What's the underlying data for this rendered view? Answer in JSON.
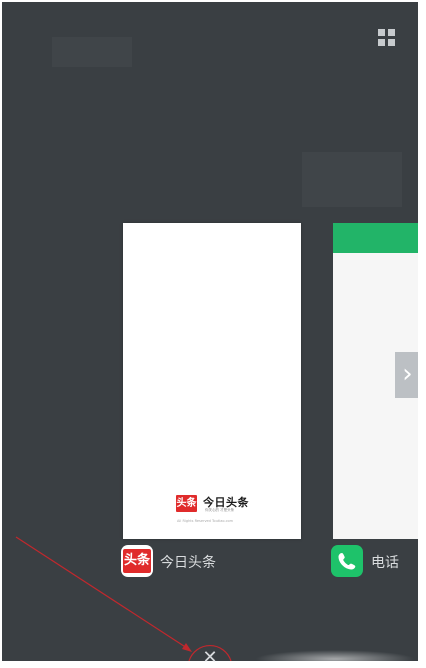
{
  "toolbar": {
    "layout_icon": "grid-view-icon"
  },
  "cards": [
    {
      "app_name": "今日头条",
      "icon_text": "头条",
      "splash": {
        "logo_text": "头条",
        "title": "今日头条",
        "slogan": "你关心的 才是头条",
        "copyright": "All Rights Reserved Toutiao.com"
      }
    },
    {
      "app_name": "电话",
      "icon": "phone-icon"
    }
  ],
  "navigation": {
    "next_icon": "chevron-right-icon"
  },
  "bottom": {
    "close_icon": "close-icon"
  },
  "colors": {
    "background": "#3a3f43",
    "toutiao_red": "#e02b2b",
    "phone_green": "#1ec26a",
    "annotation": "#c0282d"
  }
}
